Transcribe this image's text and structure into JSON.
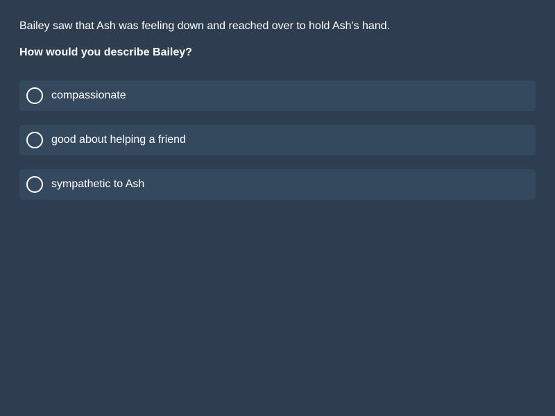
{
  "passage": "Bailey saw that Ash was feeling down and reached over to hold Ash's hand.",
  "question": "How would you describe Bailey?",
  "options": [
    {
      "label": "compassionate",
      "icon": "radio-unchecked-icon"
    },
    {
      "label": "good about helping a friend",
      "icon": "radio-unchecked-icon"
    },
    {
      "label": "sympathetic to Ash",
      "icon": "radio-unchecked-icon"
    }
  ],
  "colors": {
    "background": "#2e3d50",
    "option_background": "#35495e",
    "text": "#ffffff"
  }
}
